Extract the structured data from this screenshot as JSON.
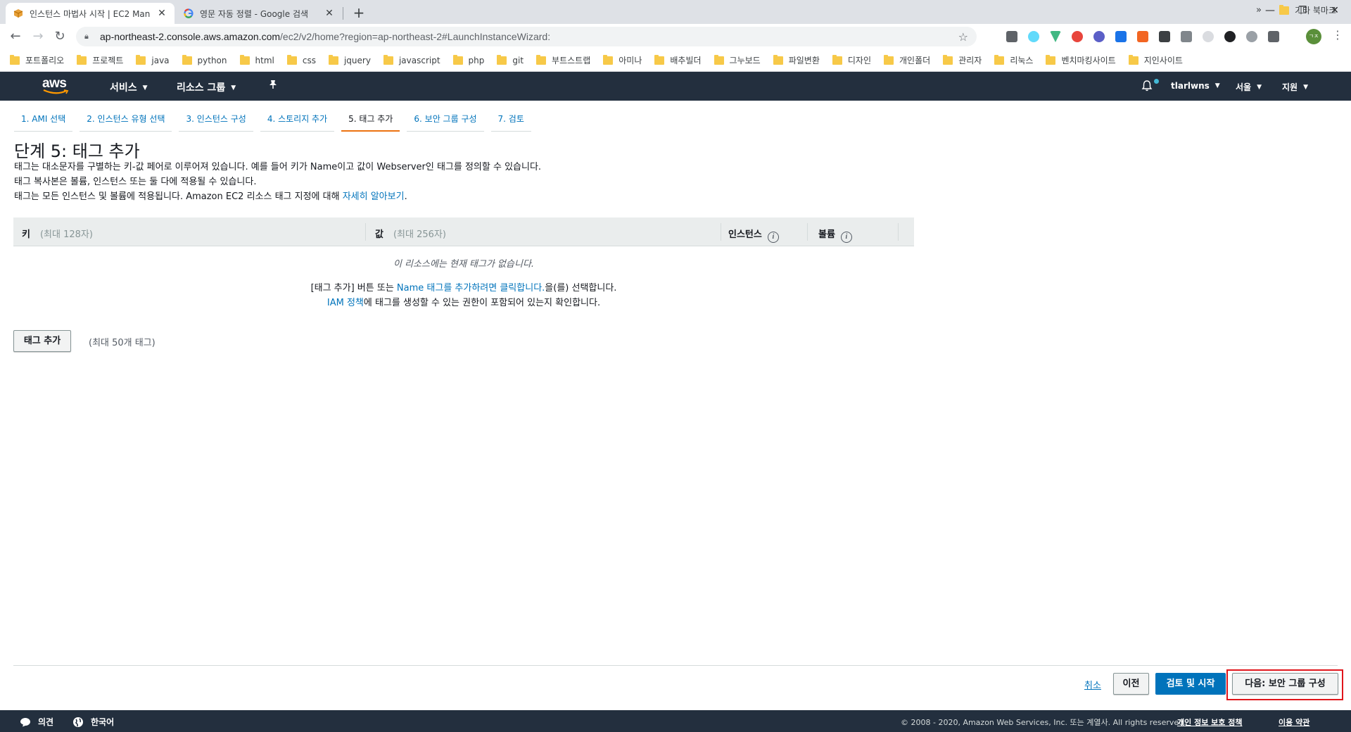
{
  "browser": {
    "tabs": [
      {
        "title": "인스턴스 마법사 시작 | EC2 Man",
        "favicon": "aws-box-icon",
        "active": true
      },
      {
        "title": "영문 자동 정렬 - Google 검색",
        "favicon": "google-g-icon",
        "active": false
      }
    ],
    "close_glyph": "✕",
    "new_tab_glyph": "+",
    "window_controls": {
      "minimize": "—",
      "restore": "❐",
      "close": "✕"
    },
    "url_host": "ap-northeast-2.console.aws.amazon.com",
    "url_path": "/ec2/v2/home?region=ap-northeast-2#LaunchInstanceWizard:",
    "profile_initials": "ㄱㅈ",
    "bookmarks": [
      "포트폴리오",
      "프로젝트",
      "java",
      "python",
      "html",
      "css",
      "jquery",
      "javascript",
      "php",
      "git",
      "부트스트랩",
      "아미나",
      "배추빌더",
      "그누보드",
      "파일변환",
      "디자인",
      "개인폴더",
      "관리자",
      "리눅스",
      "벤치마킹사이트",
      "지인사이트"
    ],
    "bookmarks_more": "»",
    "bookmarks_other": "기타 북마크"
  },
  "aws_nav": {
    "logo_text": "aws",
    "services": "서비스",
    "resource_groups": "리소스 그룹",
    "username": "tlarlwns",
    "region": "서울",
    "support": "지원"
  },
  "wizard": {
    "steps": [
      "1. AMI 선택",
      "2. 인스턴스 유형 선택",
      "3. 인스턴스 구성",
      "4. 스토리지 추가",
      "5. 태그 추가",
      "6. 보안 그룹 구성",
      "7. 검토"
    ],
    "active_step_index": 4
  },
  "page": {
    "title": "단계 5: 태그 추가",
    "desc1": "태그는 대소문자를 구별하는 키-값 페어로 이루어져 있습니다. 예를 들어 키가 Name이고 값이 Webserver인 태그를 정의할 수 있습니다.",
    "desc2": "태그 복사본은 볼륨, 인스턴스 또는 둘 다에 적용될 수 있습니다.",
    "desc3_prefix": "태그는 모든 인스턴스 및 볼륨에 적용됩니다. Amazon EC2 리소스 태그 지정에 대해 ",
    "desc3_link": "자세히 알아보기",
    "desc3_suffix": "."
  },
  "table": {
    "col_key": "키",
    "col_key_hint": "(최대 128자)",
    "col_value": "값",
    "col_value_hint": "(최대 256자)",
    "col_instance": "인스턴스",
    "col_volume": "볼륨",
    "info_glyph": "i",
    "empty_text": "이 리소스에는 현재 태그가 없습니다.",
    "help1_prefix": "[태그 추가] 버튼 또는 ",
    "help1_link": "Name 태그를 추가하려면 클릭합니다.",
    "help1_suffix": "을(를) 선택합니다.",
    "help2_link": "IAM 정책",
    "help2_suffix": "에 태그를 생성할 수 있는 권한이 포함되어 있는지 확인합니다."
  },
  "actions": {
    "add_tag": "태그 추가",
    "add_tag_hint": "(최대 50개 태그)",
    "cancel": "취소",
    "previous": "이전",
    "review_launch": "검토 및 시작",
    "next": "다음: 보안 그룹 구성"
  },
  "footer": {
    "feedback": "의견",
    "language": "한국어",
    "copyright": "© 2008 - 2020, Amazon Web Services, Inc. 또는 계열사. All rights reserved.",
    "privacy": "개인 정보 보호 정책",
    "terms": "이용 약관"
  },
  "colors": {
    "aws_nav_bg": "#232f3e",
    "link": "#0073bb",
    "primary_button": "#0073bb",
    "active_step_underline": "#ec7211",
    "annotation_box": "#e0161c"
  }
}
